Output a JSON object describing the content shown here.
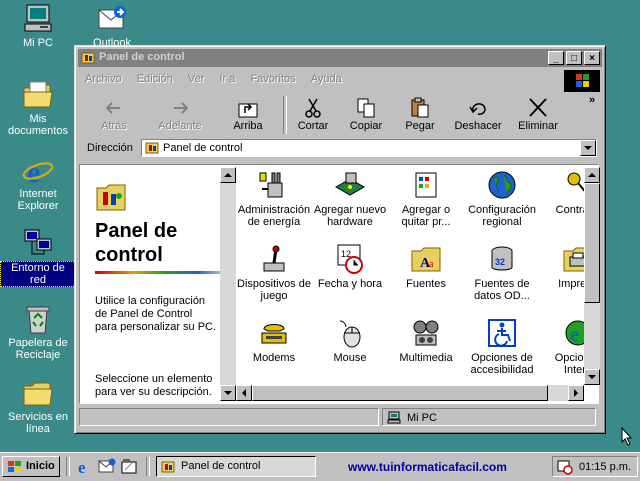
{
  "desktop": {
    "icons": [
      {
        "label": "Mi PC"
      },
      {
        "label": "Mis documentos"
      },
      {
        "label": "Internet Explorer"
      },
      {
        "label": "Entorno de red"
      },
      {
        "label": "Papelera de Reciclaje"
      },
      {
        "label": "Servicios en línea"
      },
      {
        "label": "Outlook Express"
      }
    ]
  },
  "window": {
    "title": "Panel de control",
    "controls": {
      "minimize": "_",
      "maximize": "□",
      "close": "×"
    },
    "menu": [
      "Archivo",
      "Edición",
      "Ver",
      "Ir a",
      "Favoritos",
      "Ayuda"
    ],
    "toolbar": {
      "back": "Atrás",
      "forward": "Adelante",
      "up": "Arriba",
      "cut": "Cortar",
      "copy": "Copiar",
      "paste": "Pegar",
      "undo": "Deshacer",
      "delete": "Eliminar",
      "more": "»"
    },
    "address": {
      "label": "Dirección",
      "value": "Panel de control"
    },
    "left_pane": {
      "title": "Panel de control",
      "description": "Utilice la configuración de Panel de Control para personalizar su PC.",
      "hint": "Seleccione un elemento para ver su descripción."
    },
    "items": [
      {
        "label": "Administración de energía"
      },
      {
        "label": "Agregar nuevo hardware"
      },
      {
        "label": "Agregar o quitar pr..."
      },
      {
        "label": "Configuración regional"
      },
      {
        "label": "Contrase"
      },
      {
        "label": "Dispositivos de juego"
      },
      {
        "label": "Fecha y hora"
      },
      {
        "label": "Fuentes"
      },
      {
        "label": "Fuentes de datos OD..."
      },
      {
        "label": "Impreso"
      },
      {
        "label": "Modems"
      },
      {
        "label": "Mouse"
      },
      {
        "label": "Multimedia"
      },
      {
        "label": "Opciones de accesibilidad"
      },
      {
        "label": "Opciones Intern"
      }
    ],
    "status": {
      "zone": "Mi PC"
    }
  },
  "taskbar": {
    "start": "Inicio",
    "task": "Panel de control",
    "url": "www.tuinformaticafacil.com",
    "clock": "01:15 p.m."
  }
}
